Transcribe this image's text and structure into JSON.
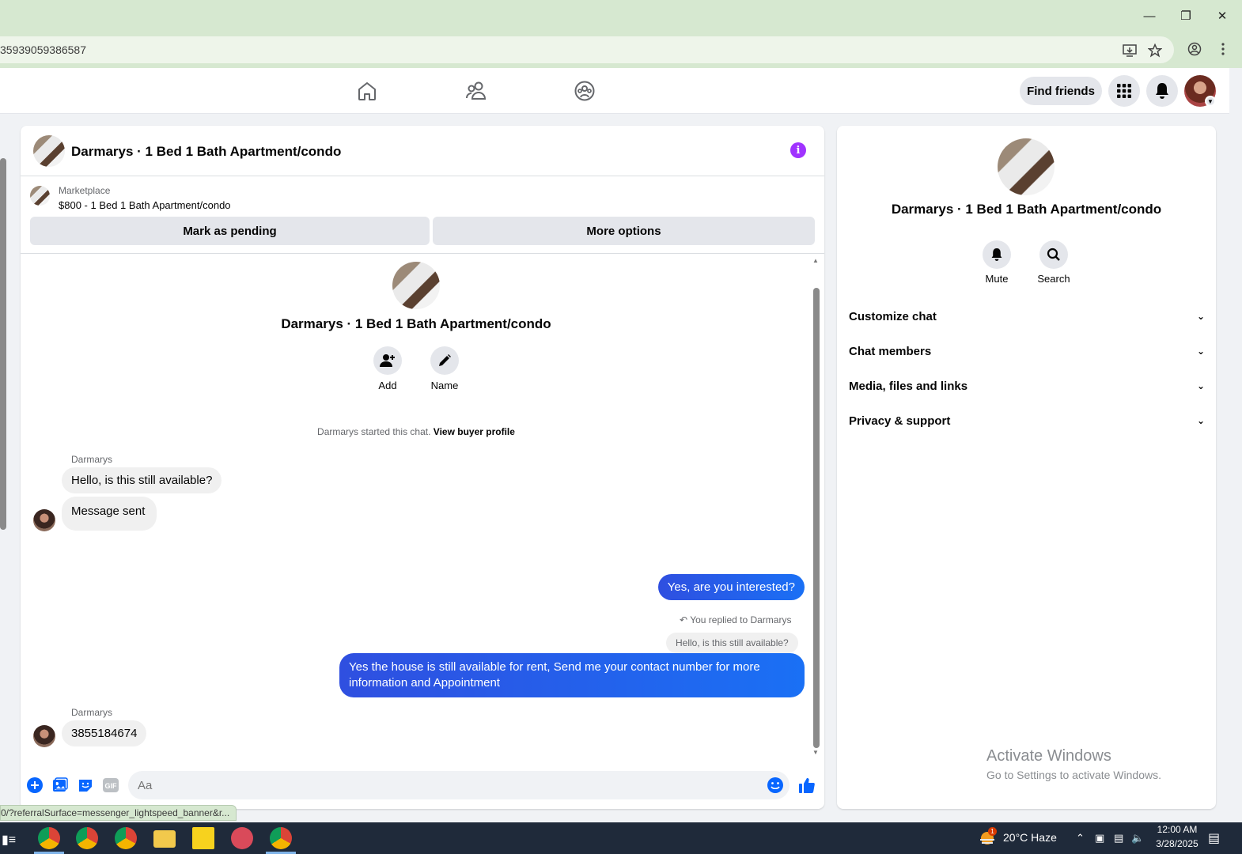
{
  "browser": {
    "url": "35939059386587",
    "status_url": "0/?referralSurface=messenger_lightspeed_banner&r..."
  },
  "nav": {
    "find_friends": "Find friends",
    "icons": [
      "home-icon",
      "friends-icon",
      "groups-icon"
    ]
  },
  "chat": {
    "title": "Darmarys · 1 Bed 1 Bath Apartment/condo",
    "marketplace_label": "Marketplace",
    "listing": "$800 - 1 Bed 1 Bath Apartment/condo",
    "mark_pending": "Mark as pending",
    "more_options": "More options",
    "center_name": "Darmarys · 1 Bed 1 Bath Apartment/condo",
    "add_label": "Add",
    "name_label": "Name",
    "started_text": "Darmarys started this chat.",
    "view_buyer": "View buyer profile",
    "messages": {
      "sender1": "Darmarys",
      "in1": "Hello, is this still available?",
      "in2": "Message sent",
      "out1": "Yes, are you interested?",
      "replied": "You replied to Darmarys",
      "quote": "Hello, is this still available?",
      "out2": "Yes the house is still available for rent, Send me your contact number for more information and Appointment",
      "sender2": "Darmarys",
      "in3": "3855184674"
    },
    "composer_placeholder": "Aa"
  },
  "side": {
    "name": "Darmarys · 1 Bed 1 Bath Apartment/condo",
    "mute": "Mute",
    "search": "Search",
    "rows": [
      "Customize chat",
      "Chat members",
      "Media, files and links",
      "Privacy & support"
    ],
    "activate_title": "Activate Windows",
    "activate_sub": "Go to Settings to activate Windows."
  },
  "taskbar": {
    "weather": "20°C  Haze",
    "weather_badge": "1",
    "time": "12:00 AM",
    "date": "3/28/2025"
  },
  "colors": {
    "accent_blue": "#1877f2",
    "info_purple": "#a033ff",
    "chrome_green": "#d6e8d0"
  }
}
